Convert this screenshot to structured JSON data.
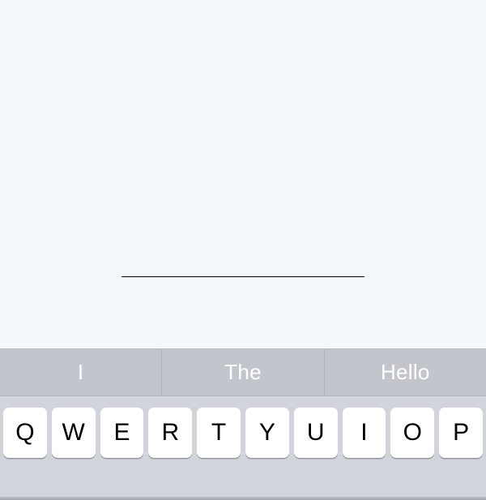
{
  "input": {
    "value": "",
    "placeholder": ""
  },
  "suggestions": [
    "I",
    "The",
    "Hello"
  ],
  "keys_row1": [
    "Q",
    "W",
    "E",
    "R",
    "T",
    "Y",
    "U",
    "I",
    "O",
    "P"
  ]
}
